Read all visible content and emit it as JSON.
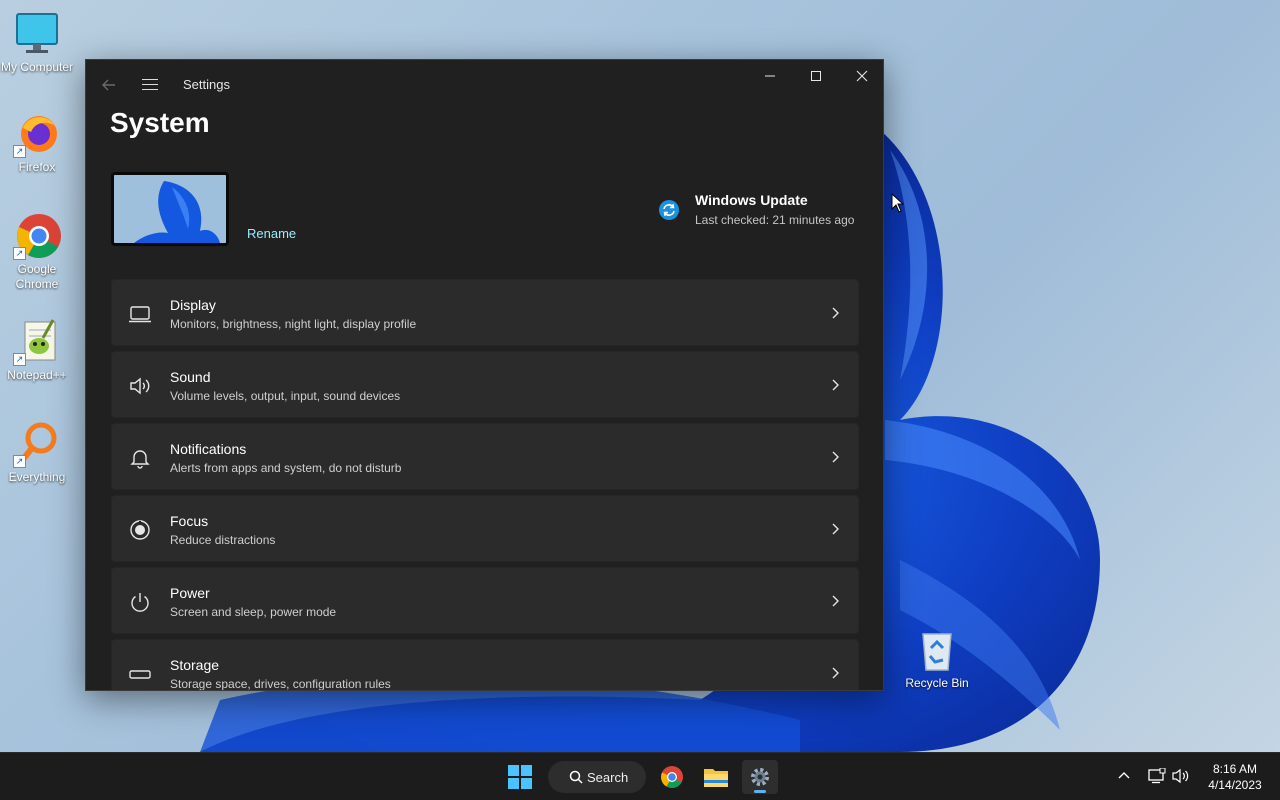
{
  "desktop": {
    "icons": [
      {
        "label": "My Computer"
      },
      {
        "label": "Firefox"
      },
      {
        "label": "Google Chrome"
      },
      {
        "label": "Notepad++"
      },
      {
        "label": "Everything"
      }
    ],
    "recycle_bin": {
      "label": "Recycle Bin"
    }
  },
  "window": {
    "title": "Settings",
    "page_title": "System",
    "device": {
      "rename_label": "Rename"
    },
    "windows_update": {
      "title": "Windows Update",
      "status": "Last checked: 21 minutes ago"
    },
    "settings_items": [
      {
        "icon": "display-icon",
        "title": "Display",
        "subtitle": "Monitors, brightness, night light, display profile"
      },
      {
        "icon": "sound-icon",
        "title": "Sound",
        "subtitle": "Volume levels, output, input, sound devices"
      },
      {
        "icon": "notifications-bell-icon",
        "title": "Notifications",
        "subtitle": "Alerts from apps and system, do not disturb"
      },
      {
        "icon": "focus-icon",
        "title": "Focus",
        "subtitle": "Reduce distractions"
      },
      {
        "icon": "power-icon",
        "title": "Power",
        "subtitle": "Screen and sleep, power mode"
      },
      {
        "icon": "storage-icon",
        "title": "Storage",
        "subtitle": "Storage space, drives, configuration rules"
      }
    ]
  },
  "taskbar": {
    "search_label": "Search",
    "clock": {
      "time": "8:16 AM",
      "date": "4/14/2023"
    }
  },
  "colors": {
    "accent": "#99ebff",
    "window_bg": "#202020",
    "card_bg": "#2b2b2b",
    "taskbar_bg": "#1c1c1c"
  }
}
